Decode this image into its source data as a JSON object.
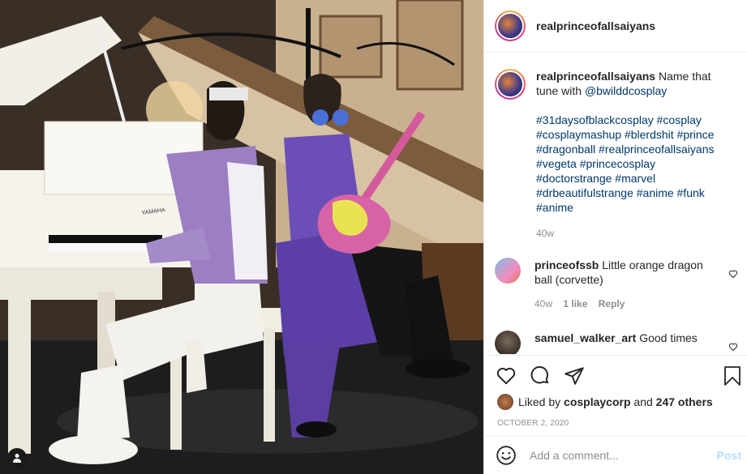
{
  "post": {
    "author": "realprinceofallsaiyans",
    "caption_text": "Name that tune with",
    "caption_mention": "@bwilddcosplay",
    "hashtags": "#31daysofblackcosplay #cosplay #cosplaymashup #blerdshit #prince #dragonball #realprinceofallsaiyans #vegeta #princecosplay #doctorstrange #marvel #drbeautifulstrange #anime #funk #anime",
    "caption_age": "40w",
    "photo_alt": "Two cosplayers at a white grand piano, one in a purple-and-white outfit playing piano and one in purple holding a yellow symbol guitar",
    "piano_brand": "YAMAHA"
  },
  "comments": [
    {
      "user": "princeofssb",
      "text": "Little orange dragon ball (corvette)",
      "age": "40w",
      "likes": "1 like",
      "reply": "Reply"
    },
    {
      "user": "samuel_walker_art",
      "text": "Good times"
    }
  ],
  "likes": {
    "prefix": "Liked by",
    "user": "cosplaycorp",
    "middle": "and",
    "count": "247 others"
  },
  "date": "OCTOBER 2, 2020",
  "add_comment": {
    "placeholder": "Add a comment...",
    "post_label": "Post"
  },
  "icons": [
    "heart-icon",
    "comment-icon",
    "share-icon",
    "bookmark-icon",
    "smile-icon",
    "user-tag-icon"
  ],
  "colors": {
    "link": "#00376b",
    "muted": "#8e8e8e",
    "post_disabled": "#b2dffc"
  }
}
